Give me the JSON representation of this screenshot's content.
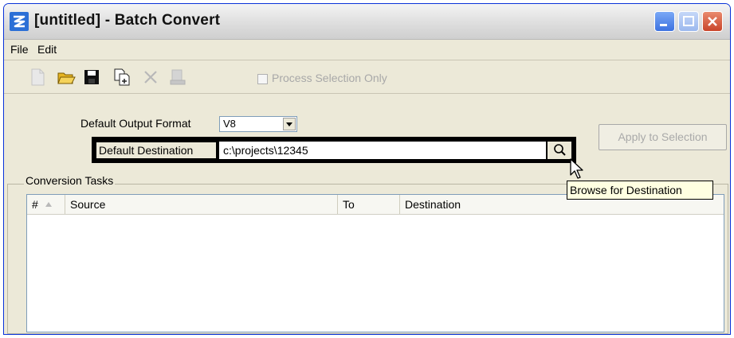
{
  "window": {
    "title": "[untitled] - Batch Convert"
  },
  "menu": {
    "file": "File",
    "edit": "Edit"
  },
  "toolbar": {
    "process_selection_label": "Process Selection Only",
    "process_selection_checked": false
  },
  "form": {
    "output_format_label": "Default Output Format",
    "output_format_value": "V8",
    "destination_label": "Default Destination",
    "destination_value": "c:\\projects\\12345",
    "apply_button": "Apply to Selection"
  },
  "tasks": {
    "group_label": "Conversion Tasks",
    "columns": [
      "#",
      "Source",
      "To",
      "Destination"
    ],
    "rows": []
  },
  "tooltip": {
    "text": "Browse for Destination"
  },
  "colors": {
    "accent": "#0831d9",
    "tooltip_bg": "#ffffe1",
    "dialog_bg": "#ece9d8"
  }
}
